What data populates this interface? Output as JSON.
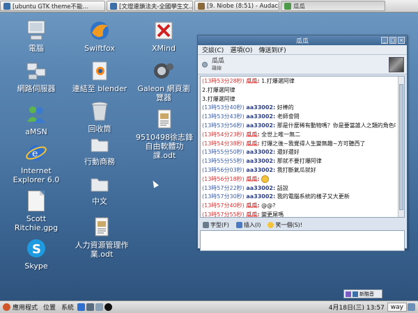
{
  "taskbar": {
    "tasks": [
      {
        "label": "[ubuntu GTK theme不能..."
      },
      {
        "label": "[文燈連鎖法夫-全國學生文..."
      },
      {
        "label": "[9. Niobe (8:51) - Audacio..."
      },
      {
        "label": "瓜瓜"
      }
    ]
  },
  "desktop": {
    "icons": [
      {
        "label": "電腦",
        "icon": "computer-icon"
      },
      {
        "label": "Swiftfox",
        "icon": "swiftfox-icon"
      },
      {
        "label": "XMind",
        "icon": "xmind-icon"
      },
      {
        "label": "網路伺服器",
        "icon": "network-servers-icon"
      },
      {
        "label": "連結至 blender",
        "icon": "blender-icon"
      },
      {
        "label": "Galeon 網頁瀏覽器",
        "icon": "galeon-icon"
      },
      {
        "label": "aMSN",
        "icon": "amsn-icon"
      },
      {
        "label": "回收筒",
        "icon": "trash-icon"
      },
      {
        "label": "9510498徐志鋒自由軟體功課.odt",
        "icon": "document-icon"
      },
      {
        "label": "Internet Explorer 6.0",
        "icon": "internet-explorer-icon"
      },
      {
        "label": "行動商務",
        "icon": "folder-icon"
      },
      {
        "label": "中文",
        "icon": "folder-icon"
      },
      {
        "label": "Scott Ritchie.gpg",
        "icon": "file-icon"
      },
      {
        "label": "人力資源管理作業.odt",
        "icon": "document-icon"
      },
      {
        "label": "Skype",
        "icon": "skype-icon"
      }
    ]
  },
  "chat": {
    "title": "瓜瓜",
    "menu": [
      "交談(C)",
      "選項(O)",
      "傳送到(F)"
    ],
    "contact_name": "瓜瓜",
    "contact_status": "離線",
    "messages": [
      {
        "time": "(13時53分28秒)",
        "name": "瓜瓜:",
        "text": "1.打爆選阿律",
        "speaker": "a"
      },
      {
        "time": "",
        "name": "",
        "text": "2.打爆選阿律",
        "speaker": "a"
      },
      {
        "time": "",
        "name": "",
        "text": "3.打爆選阿律",
        "speaker": "a"
      },
      {
        "time": "(13時53分40秒)",
        "name": "aa33002:",
        "text": "好棒的",
        "speaker": "b"
      },
      {
        "time": "(13時53分43秒)",
        "name": "aa33002:",
        "text": "老師會問",
        "speaker": "b"
      },
      {
        "time": "(13時53分56秒)",
        "name": "aa33002:",
        "text": "那是什麼稀有動物嗎？你是要當誰人之類的角色嗎",
        "speaker": "b"
      },
      {
        "time": "(13時54分23秒)",
        "name": "瓜瓜:",
        "text": "全世上唯一無二",
        "speaker": "a"
      },
      {
        "time": "(13時54分38秒)",
        "name": "瓜瓜:",
        "text": "打爆之後~我覺得人生變無趣~方可聽西了",
        "speaker": "a"
      },
      {
        "time": "(13時55分50秒)",
        "name": "aa33002:",
        "text": "還好還好",
        "speaker": "b"
      },
      {
        "time": "(13時55分55秒)",
        "name": "aa33002:",
        "text": "那就不要打爆阿律",
        "speaker": "b"
      },
      {
        "time": "(13時56分03秒)",
        "name": "aa33002:",
        "text": "我打斷氣瓜就好",
        "speaker": "b"
      },
      {
        "time": "(13時56分18秒)",
        "name": "瓜瓜:",
        "text": "",
        "speaker": "a",
        "emoticon": true
      },
      {
        "time": "(13時57分22秒)",
        "name": "aa33002:",
        "text": "話說",
        "speaker": "b"
      },
      {
        "time": "(13時57分30秒)",
        "name": "aa33002:",
        "text": "我的電腦系統的樣子又大更新",
        "speaker": "b"
      },
      {
        "time": "(13時57分40秒)",
        "name": "瓜瓜:",
        "text": "@@?",
        "speaker": "a"
      },
      {
        "time": "(13時57分55秒)",
        "name": "瓜瓜:",
        "text": "變更屌嗎",
        "speaker": "a"
      }
    ],
    "toolbar": {
      "font": "字型(F)",
      "insert": "插入(I)",
      "smile": "笑一個(S)!"
    }
  },
  "bottom_panel": {
    "apps_menu": "應用程式",
    "places_menu": "位置",
    "system_menu": "系統",
    "clock": "4月18日(三) 13:57",
    "user": "way",
    "tray_label": "新酷音"
  }
}
